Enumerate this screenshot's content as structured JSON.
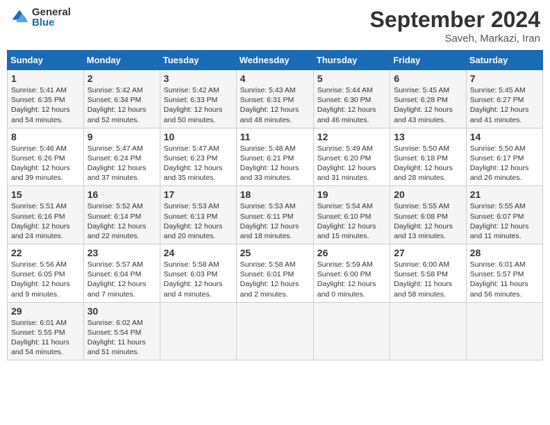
{
  "header": {
    "logo_general": "General",
    "logo_blue": "Blue",
    "month": "September 2024",
    "location": "Saveh, Markazi, Iran"
  },
  "days_of_week": [
    "Sunday",
    "Monday",
    "Tuesday",
    "Wednesday",
    "Thursday",
    "Friday",
    "Saturday"
  ],
  "weeks": [
    [
      {
        "day": "1",
        "sunrise": "5:41 AM",
        "sunset": "6:35 PM",
        "daylight": "12 hours and 54 minutes."
      },
      {
        "day": "2",
        "sunrise": "5:42 AM",
        "sunset": "6:34 PM",
        "daylight": "12 hours and 52 minutes."
      },
      {
        "day": "3",
        "sunrise": "5:42 AM",
        "sunset": "6:33 PM",
        "daylight": "12 hours and 50 minutes."
      },
      {
        "day": "4",
        "sunrise": "5:43 AM",
        "sunset": "6:31 PM",
        "daylight": "12 hours and 48 minutes."
      },
      {
        "day": "5",
        "sunrise": "5:44 AM",
        "sunset": "6:30 PM",
        "daylight": "12 hours and 46 minutes."
      },
      {
        "day": "6",
        "sunrise": "5:45 AM",
        "sunset": "6:28 PM",
        "daylight": "12 hours and 43 minutes."
      },
      {
        "day": "7",
        "sunrise": "5:45 AM",
        "sunset": "6:27 PM",
        "daylight": "12 hours and 41 minutes."
      }
    ],
    [
      {
        "day": "8",
        "sunrise": "5:46 AM",
        "sunset": "6:26 PM",
        "daylight": "12 hours and 39 minutes."
      },
      {
        "day": "9",
        "sunrise": "5:47 AM",
        "sunset": "6:24 PM",
        "daylight": "12 hours and 37 minutes."
      },
      {
        "day": "10",
        "sunrise": "5:47 AM",
        "sunset": "6:23 PM",
        "daylight": "12 hours and 35 minutes."
      },
      {
        "day": "11",
        "sunrise": "5:48 AM",
        "sunset": "6:21 PM",
        "daylight": "12 hours and 33 minutes."
      },
      {
        "day": "12",
        "sunrise": "5:49 AM",
        "sunset": "6:20 PM",
        "daylight": "12 hours and 31 minutes."
      },
      {
        "day": "13",
        "sunrise": "5:50 AM",
        "sunset": "6:18 PM",
        "daylight": "12 hours and 28 minutes."
      },
      {
        "day": "14",
        "sunrise": "5:50 AM",
        "sunset": "6:17 PM",
        "daylight": "12 hours and 26 minutes."
      }
    ],
    [
      {
        "day": "15",
        "sunrise": "5:51 AM",
        "sunset": "6:16 PM",
        "daylight": "12 hours and 24 minutes."
      },
      {
        "day": "16",
        "sunrise": "5:52 AM",
        "sunset": "6:14 PM",
        "daylight": "12 hours and 22 minutes."
      },
      {
        "day": "17",
        "sunrise": "5:53 AM",
        "sunset": "6:13 PM",
        "daylight": "12 hours and 20 minutes."
      },
      {
        "day": "18",
        "sunrise": "5:53 AM",
        "sunset": "6:11 PM",
        "daylight": "12 hours and 18 minutes."
      },
      {
        "day": "19",
        "sunrise": "5:54 AM",
        "sunset": "6:10 PM",
        "daylight": "12 hours and 15 minutes."
      },
      {
        "day": "20",
        "sunrise": "5:55 AM",
        "sunset": "6:08 PM",
        "daylight": "12 hours and 13 minutes."
      },
      {
        "day": "21",
        "sunrise": "5:55 AM",
        "sunset": "6:07 PM",
        "daylight": "12 hours and 11 minutes."
      }
    ],
    [
      {
        "day": "22",
        "sunrise": "5:56 AM",
        "sunset": "6:05 PM",
        "daylight": "12 hours and 9 minutes."
      },
      {
        "day": "23",
        "sunrise": "5:57 AM",
        "sunset": "6:04 PM",
        "daylight": "12 hours and 7 minutes."
      },
      {
        "day": "24",
        "sunrise": "5:58 AM",
        "sunset": "6:03 PM",
        "daylight": "12 hours and 4 minutes."
      },
      {
        "day": "25",
        "sunrise": "5:58 AM",
        "sunset": "6:01 PM",
        "daylight": "12 hours and 2 minutes."
      },
      {
        "day": "26",
        "sunrise": "5:59 AM",
        "sunset": "6:00 PM",
        "daylight": "12 hours and 0 minutes."
      },
      {
        "day": "27",
        "sunrise": "6:00 AM",
        "sunset": "5:58 PM",
        "daylight": "11 hours and 58 minutes."
      },
      {
        "day": "28",
        "sunrise": "6:01 AM",
        "sunset": "5:57 PM",
        "daylight": "11 hours and 56 minutes."
      }
    ],
    [
      {
        "day": "29",
        "sunrise": "6:01 AM",
        "sunset": "5:55 PM",
        "daylight": "11 hours and 54 minutes."
      },
      {
        "day": "30",
        "sunrise": "6:02 AM",
        "sunset": "5:54 PM",
        "daylight": "11 hours and 51 minutes."
      },
      {
        "day": "",
        "sunrise": "",
        "sunset": "",
        "daylight": ""
      },
      {
        "day": "",
        "sunrise": "",
        "sunset": "",
        "daylight": ""
      },
      {
        "day": "",
        "sunrise": "",
        "sunset": "",
        "daylight": ""
      },
      {
        "day": "",
        "sunrise": "",
        "sunset": "",
        "daylight": ""
      },
      {
        "day": "",
        "sunrise": "",
        "sunset": "",
        "daylight": ""
      }
    ]
  ]
}
